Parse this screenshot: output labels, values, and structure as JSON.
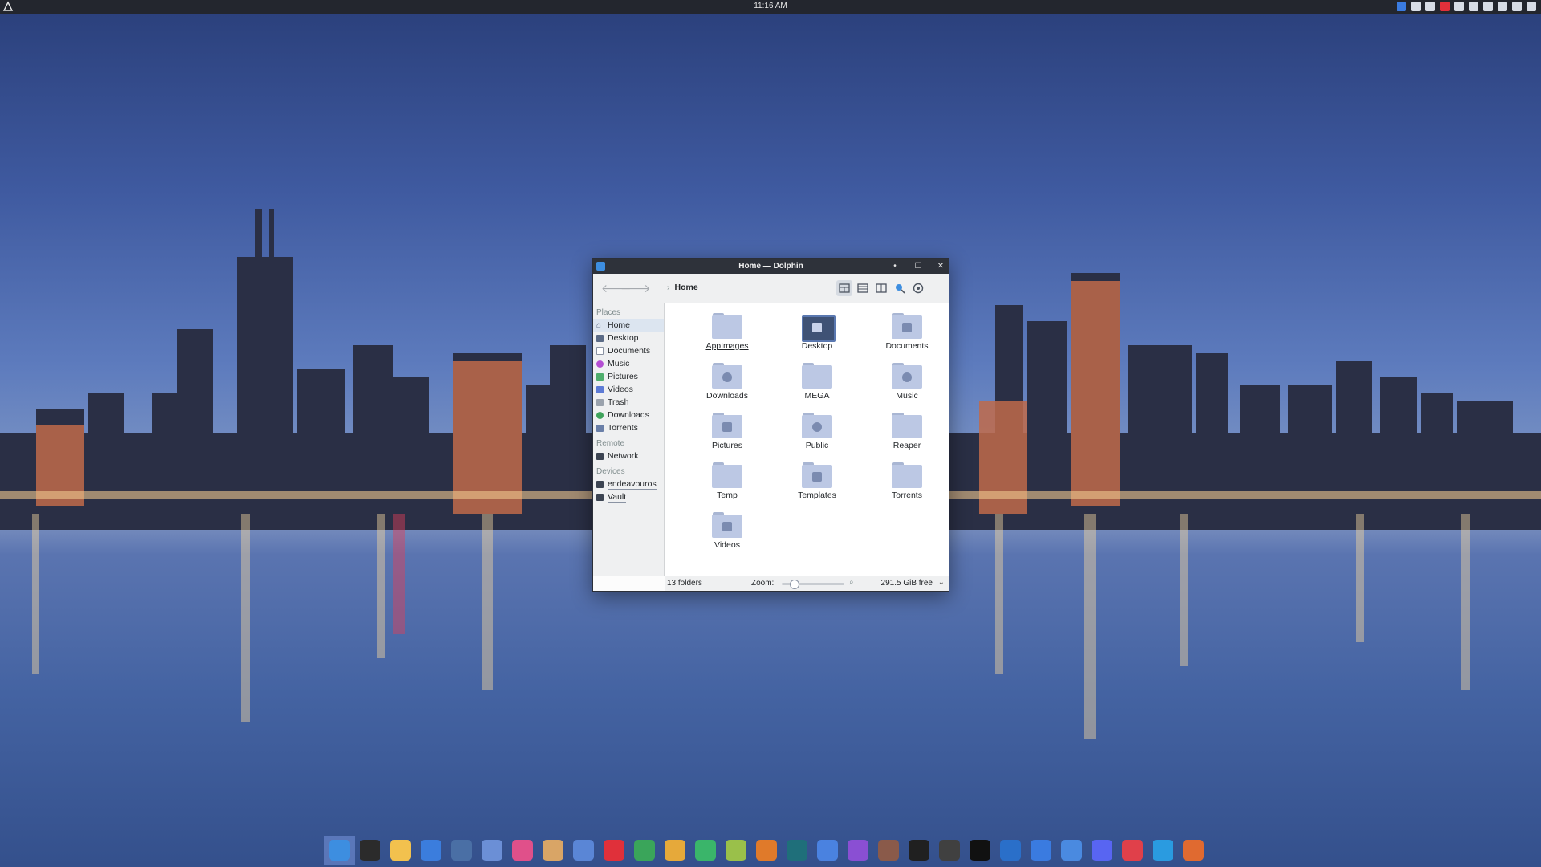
{
  "top_panel": {
    "clock": "11:16 AM"
  },
  "window": {
    "title": "Home — Dolphin",
    "breadcrumb": "Home",
    "sidebar": {
      "sections": [
        {
          "header": "Places",
          "items": [
            {
              "label": "Home",
              "icon": "home-icon",
              "selected": true
            },
            {
              "label": "Desktop",
              "icon": "desktop-icon"
            },
            {
              "label": "Documents",
              "icon": "document-icon"
            },
            {
              "label": "Music",
              "icon": "music-icon"
            },
            {
              "label": "Pictures",
              "icon": "pictures-icon"
            },
            {
              "label": "Videos",
              "icon": "videos-icon"
            },
            {
              "label": "Trash",
              "icon": "trash-icon"
            },
            {
              "label": "Downloads",
              "icon": "downloads-icon"
            },
            {
              "label": "Torrents",
              "icon": "folder-icon"
            }
          ]
        },
        {
          "header": "Remote",
          "items": [
            {
              "label": "Network",
              "icon": "network-icon"
            }
          ]
        },
        {
          "header": "Devices",
          "items": [
            {
              "label": "endeavouros",
              "icon": "drive-icon"
            },
            {
              "label": "Vault",
              "icon": "drive-icon"
            }
          ]
        }
      ]
    },
    "folders": [
      {
        "name": "AppImages",
        "icon": "folder-icon"
      },
      {
        "name": "Desktop",
        "icon": "desktop-folder-icon"
      },
      {
        "name": "Documents",
        "icon": "documents-folder-icon"
      },
      {
        "name": "Downloads",
        "icon": "downloads-folder-icon"
      },
      {
        "name": "MEGA",
        "icon": "folder-icon"
      },
      {
        "name": "Music",
        "icon": "music-folder-icon"
      },
      {
        "name": "Pictures",
        "icon": "pictures-folder-icon"
      },
      {
        "name": "Public",
        "icon": "public-folder-icon"
      },
      {
        "name": "Reaper",
        "icon": "folder-icon"
      },
      {
        "name": "Temp",
        "icon": "folder-icon"
      },
      {
        "name": "Templates",
        "icon": "templates-folder-icon"
      },
      {
        "name": "Torrents",
        "icon": "folder-icon"
      },
      {
        "name": "Videos",
        "icon": "videos-folder-icon"
      }
    ],
    "status": {
      "count": "13 folders",
      "zoom_label": "Zoom:",
      "zoom_level": 0.15,
      "free_space": "291.5 GiB free"
    }
  },
  "dock": {
    "apps": [
      {
        "name": "dolphin-icon",
        "color": "#3d8ee0",
        "active": true
      },
      {
        "name": "terminal-icon",
        "color": "#2b2b2b"
      },
      {
        "name": "notes-icon",
        "color": "#f2c14e"
      },
      {
        "name": "writer-icon",
        "color": "#3b7ddd"
      },
      {
        "name": "yakuake-icon",
        "color": "#4a6fa5"
      },
      {
        "name": "image-viewer-icon",
        "color": "#6b8fd6"
      },
      {
        "name": "color-picker-icon",
        "color": "#e0508a"
      },
      {
        "name": "game-icon",
        "color": "#d9a566"
      },
      {
        "name": "kde-connect-icon",
        "color": "#5a86d6"
      },
      {
        "name": "first-aid-icon",
        "color": "#e0303a"
      },
      {
        "name": "shield-app-icon",
        "color": "#3aa55a"
      },
      {
        "name": "carrot-icon",
        "color": "#e6a93a"
      },
      {
        "name": "recycle-icon",
        "color": "#3ab56a"
      },
      {
        "name": "music-note-icon",
        "color": "#9ac04a"
      },
      {
        "name": "obs-icon",
        "color": "#e07a2a"
      },
      {
        "name": "sidebar-app-icon",
        "color": "#1f6f7a"
      },
      {
        "name": "equalizer-icon",
        "color": "#4a82e0"
      },
      {
        "name": "media-player-icon",
        "color": "#8a4fd3"
      },
      {
        "name": "film-icon",
        "color": "#8a5a4a"
      },
      {
        "name": "youtube-icon",
        "color": "#202020"
      },
      {
        "name": "gargoyle-icon",
        "color": "#404040"
      },
      {
        "name": "letter-a-icon",
        "color": "#111111"
      },
      {
        "name": "steam-icon",
        "color": "#2a6fc9"
      },
      {
        "name": "qbittorrent-icon",
        "color": "#3a7be0"
      },
      {
        "name": "bird-icon",
        "color": "#4a8ae0"
      },
      {
        "name": "discord-icon",
        "color": "#5865f2"
      },
      {
        "name": "vivaldi-icon",
        "color": "#e0404a"
      },
      {
        "name": "telegram-icon",
        "color": "#2a9be0"
      },
      {
        "name": "firefox-icon",
        "color": "#e06a30"
      }
    ]
  }
}
